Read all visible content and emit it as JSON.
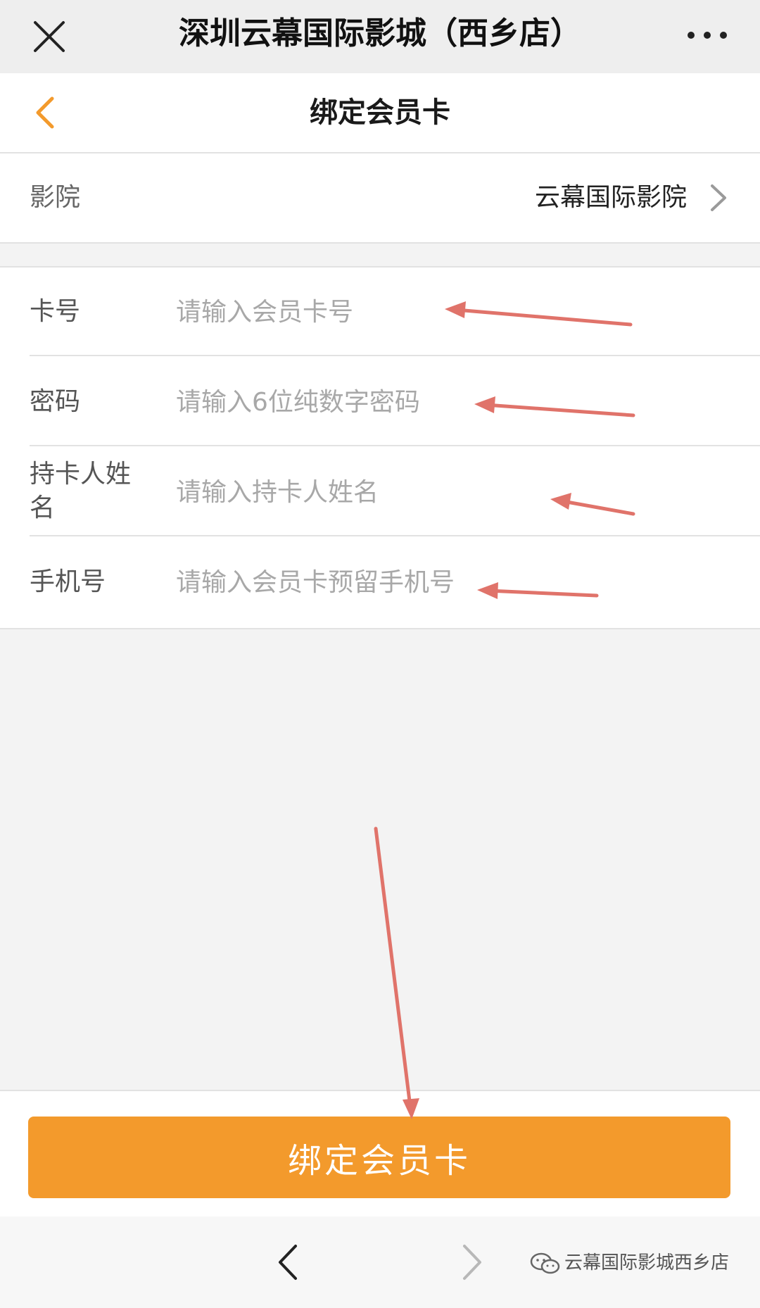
{
  "window": {
    "title": "深圳云幕国际影城（西乡店）",
    "close_icon": "close-icon",
    "more_icon": "more-dots-icon"
  },
  "header": {
    "title": "绑定会员卡",
    "back_icon": "chevron-left-icon",
    "accent_color": "#f39a2c"
  },
  "cinema": {
    "label": "影院",
    "value": "云幕国际影院",
    "icon": "chevron-right-icon"
  },
  "form": {
    "fields": [
      {
        "label": "卡号",
        "placeholder": "请输入会员卡号"
      },
      {
        "label": "密码",
        "placeholder": "请输入6位纯数字密码"
      },
      {
        "label": "持卡人姓名",
        "placeholder": "请输入持卡人姓名"
      },
      {
        "label": "手机号",
        "placeholder": "请输入会员卡预留手机号"
      }
    ]
  },
  "submit": {
    "label": "绑定会员卡",
    "color": "#f39a2c"
  },
  "nav": {
    "back_icon": "nav-back-icon",
    "forward_icon": "nav-forward-icon"
  },
  "watermark": {
    "text": "云幕国际影城西乡店",
    "icon": "wechat-icon"
  },
  "annotations": {
    "arrow_color": "#e0736a"
  }
}
